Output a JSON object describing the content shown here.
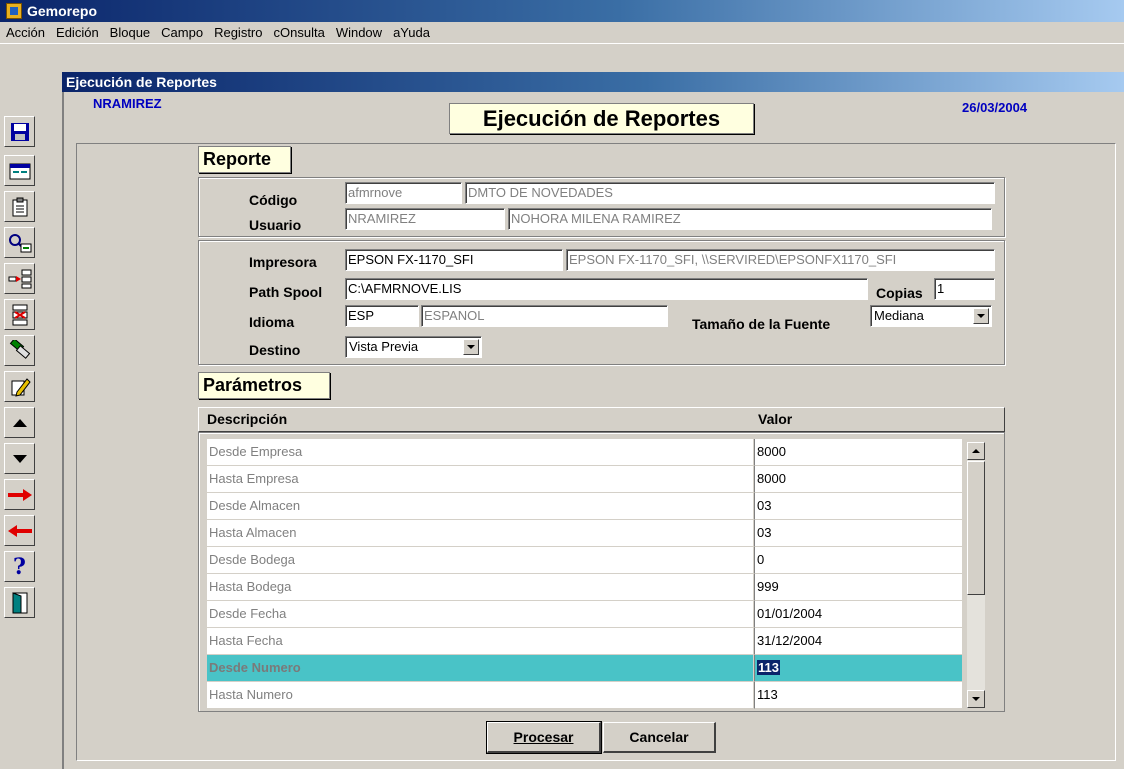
{
  "app": {
    "title": "Gemorepo"
  },
  "menu": [
    {
      "label": "Acción"
    },
    {
      "label": "Edición"
    },
    {
      "label": "Bloque"
    },
    {
      "label": "Campo"
    },
    {
      "label": "Registro"
    },
    {
      "label": "cOnsulta"
    },
    {
      "label": "Window"
    },
    {
      "label": "aYuda"
    }
  ],
  "window": {
    "title": "Ejecución de Reportes"
  },
  "header": {
    "user": "NRAMIREZ",
    "date": "26/03/2004",
    "form_title": "Ejecución de Reportes"
  },
  "reporte": {
    "section_title": "Reporte",
    "codigo_label": "Código",
    "codigo_value": "afmrnove",
    "codigo_desc": "DMTO DE NOVEDADES",
    "usuario_label": "Usuario",
    "usuario_value": "NRAMIREZ",
    "usuario_desc": "NOHORA MILENA RAMIREZ"
  },
  "config": {
    "impresora_label": "Impresora",
    "impresora_value": "EPSON FX-1170_SFI",
    "impresora_desc": "EPSON FX-1170_SFI, \\\\SERVIRED\\EPSONFX1170_SFI",
    "path_label": "Path Spool",
    "path_value": "C:\\AFMRNOVE.LIS",
    "copias_label": "Copias",
    "copias_value": "1",
    "idioma_label": "Idioma",
    "idioma_value": "ESP",
    "idioma_desc": "ESPANOL",
    "fuente_label": "Tamaño de la Fuente",
    "fuente_value": "Mediana",
    "destino_label": "Destino",
    "destino_value": "Vista Previa"
  },
  "parametros": {
    "section_title": "Parámetros",
    "col_desc": "Descripción",
    "col_valor": "Valor",
    "rows": [
      {
        "desc": "Desde Empresa",
        "valor": "8000"
      },
      {
        "desc": "Hasta Empresa",
        "valor": "8000"
      },
      {
        "desc": "Desde Almacen",
        "valor": "03"
      },
      {
        "desc": "Hasta Almacen",
        "valor": "03"
      },
      {
        "desc": "Desde Bodega",
        "valor": "0"
      },
      {
        "desc": "Hasta Bodega",
        "valor": "999"
      },
      {
        "desc": "Desde Fecha",
        "valor": "01/01/2004"
      },
      {
        "desc": "Hasta Fecha",
        "valor": "31/12/2004"
      },
      {
        "desc": "Desde Numero",
        "valor": "113"
      },
      {
        "desc": "Hasta Numero",
        "valor": "113"
      }
    ],
    "selected_row": 8
  },
  "buttons": {
    "procesar_label": "Procesar",
    "cancelar_label": "Cancelar"
  },
  "toolbar_icons": [
    "save-icon",
    "window-icon",
    "clipboard-icon",
    "query-icon",
    "insert-record-icon",
    "delete-record-icon",
    "clear-icon",
    "edit-icon",
    "up-icon",
    "down-icon",
    "next-arrow-icon",
    "previous-arrow-icon",
    "help-icon",
    "exit-icon"
  ],
  "colors": {
    "title_blue": "#0a246a",
    "selected_row": "#49c3c7",
    "label_bg": "#ffffe0",
    "header_text": "#0000c0"
  }
}
